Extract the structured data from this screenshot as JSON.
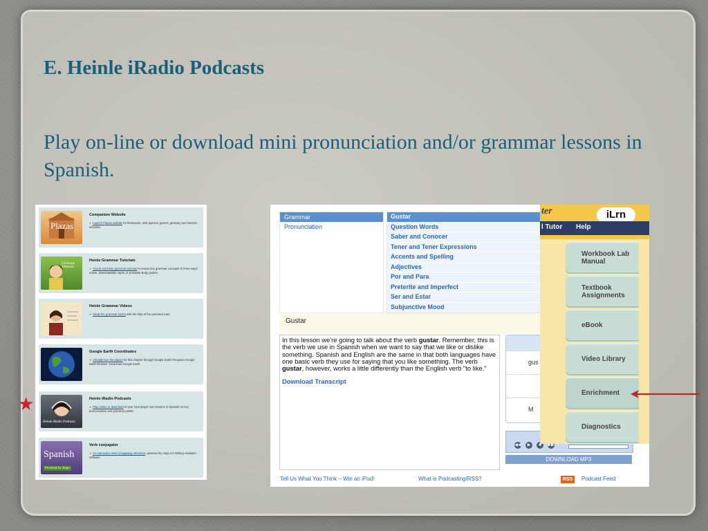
{
  "slide": {
    "title": "E. Heinle iRadio Podcasts",
    "subtitle": "Play on-line or download mini pronunciation and/or  grammar lessons in Spanish."
  },
  "left_panel": {
    "items": [
      {
        "title": "Companion Website",
        "link": "Launch Plazas website",
        "desc": " for flashcards, web quizzes, games, glossary and internet activities.",
        "thumb_text": "Plazas"
      },
      {
        "title": "Heinle Grammar Tutorials",
        "link": "Check out these grammar tutorials",
        "desc": " to review key grammar concepts in three ways: online, downloadable mp3s, or printable study guides.",
        "thumb_text": "Grammar Tutorials"
      },
      {
        "title": "Heinle Grammar Videos",
        "link": "Study the grammar topics",
        "desc": " with the help of the grammar tutor.",
        "thumb_text": ""
      },
      {
        "title": "Google Earth Coordinates",
        "link": "Virtually tour the places",
        "desc": " for this chapter through Google Earth! Requires Google Earth Browser: Download Google Earth.",
        "thumb_text": ""
      },
      {
        "title": "Heinle iRadio Podcasts",
        "link": "Play online or download",
        "desc": " to your mp3 player mini lessons in Spanish on key pronunciation and grammar points.",
        "thumb_text": "Heinle iRadio Podcasts"
      },
      {
        "title": "Verb conjugator",
        "link": "An interactive verb conjugating reference",
        "desc": "; powered by Atajo 4.0 Writing Assistant software",
        "thumb_text": "Spanish",
        "thumb_sub": "Powered by Atajo"
      }
    ]
  },
  "screenshot": {
    "categories": [
      "Grammar",
      "Pronunciation"
    ],
    "topics": [
      "Gustar",
      "Question Words",
      "Saber and Conocer",
      "Tener and Tener Expressions",
      "Accents and Spelling",
      "Adjectives",
      "Por and Para",
      "Preterite and Imperfect",
      "Ser and Estar",
      "Subjunctive Mood"
    ],
    "lesson_title": "Gustar",
    "lesson_text_parts": {
      "p1": "In this lesson we're going to talk about the verb ",
      "b1": "gustar",
      "p2": ". Remember, this is the verb we use in Spanish when we want to say that we like or dislike something. Spanish and English are the same in that both languages have one basic verb they use for saying that you like something. The verb ",
      "b2": "gustar",
      "p3": ", however, works a little differently than the English verb \"to like.\""
    },
    "download_transcript": "Download Transcript",
    "player_rows": [
      "gus",
      "",
      "M"
    ],
    "download_mp3": "DOWNLOAD MP3",
    "footer_left": "Tell Us What You Think – Win an iPod!",
    "footer_mid": "What is Podcasting/RSS?",
    "rss_badge": "RSS",
    "footer_right": "Podcast Feed"
  },
  "ilrn": {
    "header_partial": "ter",
    "logo_text": "iLrn",
    "nav": [
      "l Tutor",
      "Help"
    ],
    "tabs": [
      "Workbook Lab Manual",
      "Textbook Assignments",
      "eBook",
      "Video Library",
      "Enrichment",
      "Diagnostics"
    ],
    "highlighted_tab": "Enrichment"
  },
  "colors": {
    "title": "#1b5e7a",
    "arrow": "#c0242a",
    "star": "#d0202a"
  }
}
